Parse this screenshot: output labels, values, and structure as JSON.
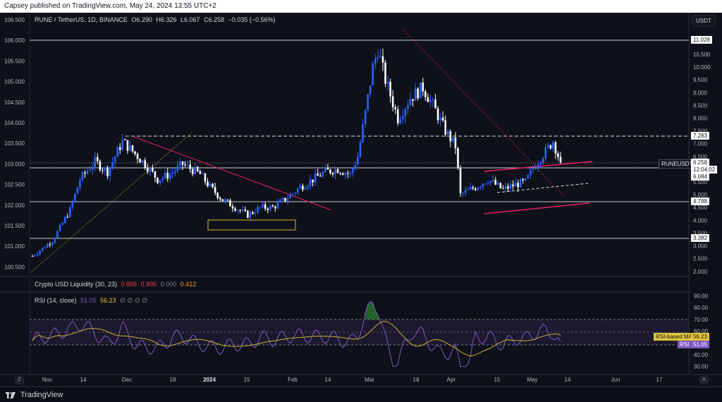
{
  "publisher": "Capsey published on TradingView.com, May 24, 2024 13:55 UTC+2",
  "header": {
    "symbol": "RUNE / TetherUS, 1D, BINANCE",
    "o_label": "O",
    "o": "6.290",
    "h_label": "H",
    "h": "6.326",
    "l_label": "L",
    "l": "6.067",
    "c_label": "C",
    "c": "6.258",
    "change": "−0.035 (−0.56%)",
    "currency": "USDT"
  },
  "left_axis": [
    "106.500",
    "106.000",
    "105.500",
    "105.000",
    "104.500",
    "104.000",
    "103.500",
    "103.000",
    "102.500",
    "102.000",
    "101.500",
    "101.000",
    "100.500"
  ],
  "right_axis": [
    "10.500",
    "10.000",
    "9.500",
    "9.000",
    "8.500",
    "8.000",
    "7.500",
    "7.000",
    "6.500",
    "6.000",
    "5.500",
    "5.000",
    "4.500",
    "4.000",
    "3.500",
    "3.000",
    "2.500",
    "2.000"
  ],
  "levels": {
    "top": "11.028",
    "resistance": "7.283",
    "current": "6.258",
    "symbol_tag": "RUNEUSDT",
    "countdown": "12:04:02",
    "pivot": "6.084",
    "support": "4.788",
    "bottom": "3.382"
  },
  "liquidity": {
    "label": "Crypto USD Liquidity (30, 23)",
    "v1": "0.895",
    "v2": "0.895",
    "v3": "0.000",
    "v4": "0.412"
  },
  "rsi": {
    "label": "RSI (14, close)",
    "v1": "51.05",
    "v2": "56.23",
    "nulls": "∅ ∅ ∅ ∅",
    "ma_tag_label": "RSI-based MA",
    "ma_tag_value": "56.23",
    "rsi_tag_label": "RSI",
    "rsi_tag_value": "51.05",
    "axis": [
      "90.00",
      "80.00",
      "70.00",
      "60.00",
      "50.00",
      "40.00",
      "30.00"
    ]
  },
  "time_axis": [
    "Nov",
    "14",
    "Dec",
    "18",
    "2024",
    "15",
    "Feb",
    "14",
    "Mar",
    "18",
    "Apr",
    "15",
    "May",
    "14",
    "Jun",
    "17"
  ],
  "footer": {
    "brand": "TradingView"
  },
  "colors": {
    "bg": "#0f111a",
    "candle_up": "#2962ff",
    "candle_down": "#ffffff",
    "trendline": "#e91e63",
    "rsi": "#7e57c2",
    "rsi_ma": "#c9b031",
    "liq_red": "#f23645",
    "liq_orange": "#ff9800"
  },
  "chart_data": {
    "type": "candlestick",
    "title": "RUNE / TetherUS, 1D, BINANCE",
    "last_close": 6.258,
    "y_range": [
      1.8,
      11.3
    ],
    "key_levels": [
      11.028,
      7.283,
      6.258,
      6.084,
      4.788,
      3.382
    ],
    "close_path": [
      [
        "2023-10-26",
        2.6
      ],
      [
        "2023-11-03",
        3.2
      ],
      [
        "2023-11-10",
        4.4
      ],
      [
        "2023-11-14",
        5.6
      ],
      [
        "2023-11-20",
        6.3
      ],
      [
        "2023-11-25",
        5.9
      ],
      [
        "2023-12-01",
        7.1
      ],
      [
        "2023-12-05",
        6.7
      ],
      [
        "2023-12-10",
        6.2
      ],
      [
        "2023-12-15",
        5.6
      ],
      [
        "2023-12-20",
        5.8
      ],
      [
        "2023-12-25",
        6.2
      ],
      [
        "2024-01-01",
        5.8
      ],
      [
        "2024-01-05",
        5.3
      ],
      [
        "2024-01-10",
        4.8
      ],
      [
        "2024-01-15",
        4.5
      ],
      [
        "2024-01-20",
        4.2
      ],
      [
        "2024-01-25",
        4.5
      ],
      [
        "2024-01-30",
        4.5
      ],
      [
        "2024-02-05",
        4.9
      ],
      [
        "2024-02-10",
        5.3
      ],
      [
        "2024-02-15",
        5.6
      ],
      [
        "2024-02-20",
        5.9
      ],
      [
        "2024-02-25",
        6.0
      ],
      [
        "2024-03-01",
        5.8
      ],
      [
        "2024-03-04",
        6.5
      ],
      [
        "2024-03-07",
        8.2
      ],
      [
        "2024-03-10",
        10.0
      ],
      [
        "2024-03-12",
        10.7
      ],
      [
        "2024-03-15",
        9.5
      ],
      [
        "2024-03-20",
        8.0
      ],
      [
        "2024-03-25",
        8.8
      ],
      [
        "2024-03-30",
        9.2
      ],
      [
        "2024-04-03",
        8.5
      ],
      [
        "2024-04-08",
        7.5
      ],
      [
        "2024-04-12",
        6.9
      ],
      [
        "2024-04-14",
        5.0
      ],
      [
        "2024-04-20",
        5.3
      ],
      [
        "2024-04-25",
        5.6
      ],
      [
        "2024-05-01",
        5.2
      ],
      [
        "2024-05-06",
        5.4
      ],
      [
        "2024-05-10",
        5.5
      ],
      [
        "2024-05-14",
        6.2
      ],
      [
        "2024-05-18",
        6.7
      ],
      [
        "2024-05-21",
        7.1
      ],
      [
        "2024-05-24",
        6.258
      ]
    ],
    "rsi_range": [
      25,
      92
    ]
  }
}
